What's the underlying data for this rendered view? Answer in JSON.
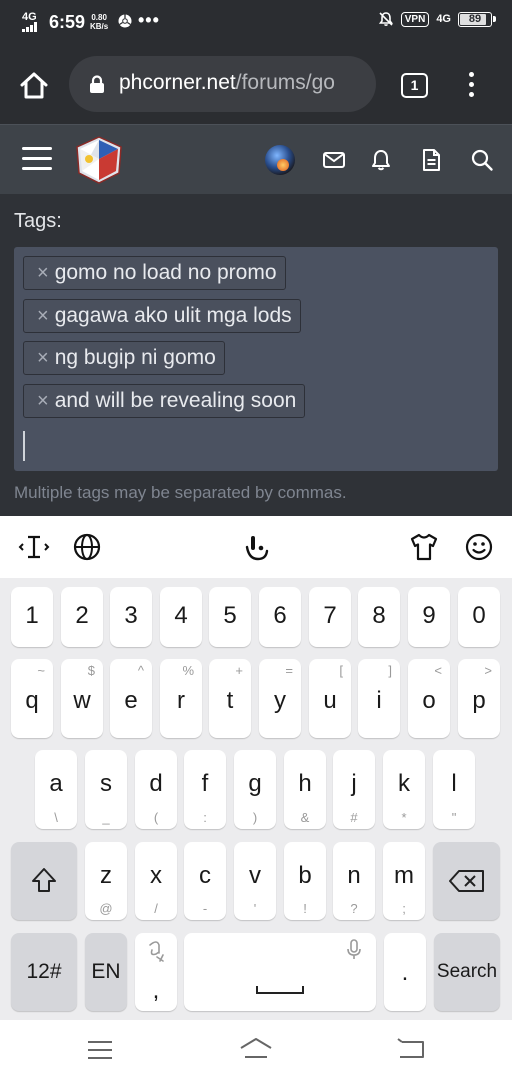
{
  "status_bar": {
    "signal": "4G",
    "time": "6:59",
    "speed_value": "0.80",
    "speed_unit": "KB/s",
    "overflow": "•••",
    "vpn": "VPN",
    "network": "4G",
    "battery": "89",
    "battery_level": 0.89
  },
  "browser": {
    "url_domain": "phcorner.net",
    "url_path": "/forums/go",
    "tab_count": "1"
  },
  "form": {
    "tags_label": "Tags:",
    "tags": [
      "gomo no load no promo",
      "gagawa ako ulit mga lods",
      "ng bugip ni gomo",
      "and will be revealing soon"
    ],
    "remove_symbol": "×",
    "hint": "Multiple tags may be separated by commas."
  },
  "keyboard": {
    "numbers": [
      "1",
      "2",
      "3",
      "4",
      "5",
      "6",
      "7",
      "8",
      "9",
      "0"
    ],
    "row1": [
      {
        "k": "q",
        "s": "~"
      },
      {
        "k": "w",
        "s": "$"
      },
      {
        "k": "e",
        "s": "^"
      },
      {
        "k": "r",
        "s": "%"
      },
      {
        "k": "t",
        "s": "+"
      },
      {
        "k": "y",
        "s": "="
      },
      {
        "k": "u",
        "s": "["
      },
      {
        "k": "i",
        "s": "]"
      },
      {
        "k": "o",
        "s": "<"
      },
      {
        "k": "p",
        "s": ">"
      }
    ],
    "row2": [
      {
        "k": "a",
        "s": "\\"
      },
      {
        "k": "s",
        "s": "_"
      },
      {
        "k": "d",
        "s": "("
      },
      {
        "k": "f",
        "s": ":"
      },
      {
        "k": "g",
        "s": ")"
      },
      {
        "k": "h",
        "s": "&"
      },
      {
        "k": "j",
        "s": "#"
      },
      {
        "k": "k",
        "s": "*"
      },
      {
        "k": "l",
        "s": "\""
      }
    ],
    "row3": [
      {
        "k": "z",
        "s": "@"
      },
      {
        "k": "x",
        "s": "/"
      },
      {
        "k": "c",
        "s": "-"
      },
      {
        "k": "v",
        "s": "'"
      },
      {
        "k": "b",
        "s": "!"
      },
      {
        "k": "n",
        "s": "?"
      },
      {
        "k": "m",
        "s": ";"
      }
    ],
    "symbols_key": "12#",
    "language_key": "EN",
    "comma_key": ",",
    "period_key": ".",
    "search_key": "Search"
  }
}
